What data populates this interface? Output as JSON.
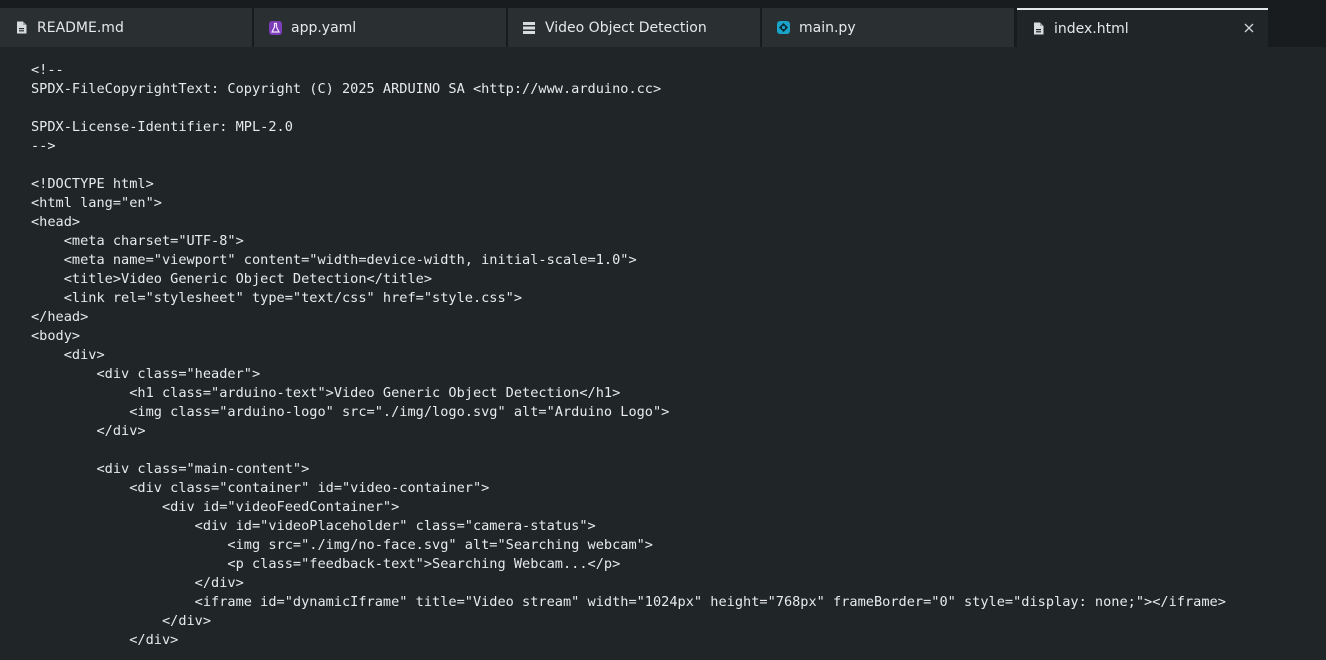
{
  "tabs": [
    {
      "label": "README.md",
      "icon": "file-icon",
      "active": false
    },
    {
      "label": "app.yaml",
      "icon": "flask-icon",
      "active": false
    },
    {
      "label": "Video Object Detection",
      "icon": "app-grid-icon",
      "active": false
    },
    {
      "label": "main.py",
      "icon": "python-icon",
      "active": false
    },
    {
      "label": "index.html",
      "icon": "file-icon",
      "active": true
    }
  ],
  "editor": {
    "lines": [
      "<!--",
      "SPDX-FileCopyrightText: Copyright (C) 2025 ARDUINO SA <http://www.arduino.cc>",
      "",
      "SPDX-License-Identifier: MPL-2.0",
      "-->",
      "",
      "<!DOCTYPE html>",
      "<html lang=\"en\">",
      "<head>",
      "    <meta charset=\"UTF-8\">",
      "    <meta name=\"viewport\" content=\"width=device-width, initial-scale=1.0\">",
      "    <title>Video Generic Object Detection</title>",
      "    <link rel=\"stylesheet\" type=\"text/css\" href=\"style.css\">",
      "</head>",
      "<body>",
      "    <div>",
      "        <div class=\"header\">",
      "            <h1 class=\"arduino-text\">Video Generic Object Detection</h1>",
      "            <img class=\"arduino-logo\" src=\"./img/logo.svg\" alt=\"Arduino Logo\">",
      "        </div>",
      "",
      "        <div class=\"main-content\">",
      "            <div class=\"container\" id=\"video-container\">",
      "                <div id=\"videoFeedContainer\">",
      "                    <div id=\"videoPlaceholder\" class=\"camera-status\">",
      "                        <img src=\"./img/no-face.svg\" alt=\"Searching webcam\">",
      "                        <p class=\"feedback-text\">Searching Webcam...</p>",
      "                    </div>",
      "                    <iframe id=\"dynamicIframe\" title=\"Video stream\" width=\"1024px\" height=\"768px\" frameBorder=\"0\" style=\"display: none;\"></iframe>",
      "                </div>",
      "            </div>"
    ]
  },
  "colors": {
    "background": "#202527",
    "tabbar": "#181c1e",
    "tab": "#2a2f32",
    "text": "#e8eaec",
    "flask_icon": "#7c3db8",
    "python_icon": "#1aa3c9"
  }
}
